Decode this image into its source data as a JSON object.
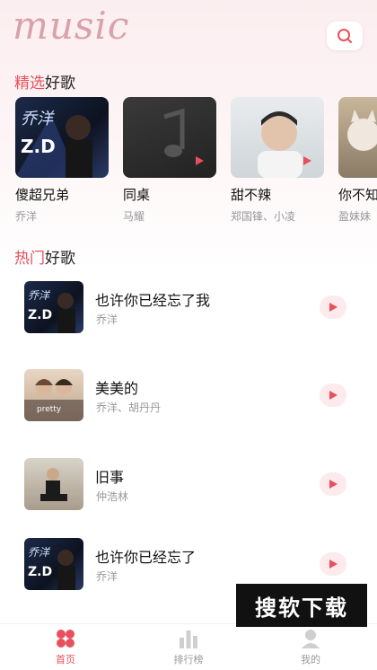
{
  "app": {
    "logo_text": "music"
  },
  "search": {
    "icon": "search-icon"
  },
  "featured_section": {
    "title_accent": "精选",
    "title_rest": "好歌"
  },
  "featured": [
    {
      "title": "傻超兄弟",
      "artist": "乔洋"
    },
    {
      "title": "同桌",
      "artist": "马耀"
    },
    {
      "title": "甜不辣",
      "artist": "郑国锋、小凌"
    },
    {
      "title": "你不知",
      "artist": "盈妹妹"
    }
  ],
  "hot_section": {
    "title_accent": "热门",
    "title_rest": "好歌"
  },
  "hot": [
    {
      "title": "也许你已经忘了我",
      "artist": "乔洋"
    },
    {
      "title": "美美的",
      "artist": "乔洋、胡丹丹",
      "cover_text": "pretty"
    },
    {
      "title": "旧事",
      "artist": "仲浩林"
    },
    {
      "title": "也许你已经忘了",
      "artist": "乔洋"
    }
  ],
  "watermark": {
    "text": "搜软下载"
  },
  "nav": {
    "home": "首页",
    "rank": "排行榜",
    "mine": "我的"
  },
  "colors": {
    "accent": "#e8505b",
    "play_bg": "#fdeaec",
    "muted": "#999999"
  }
}
